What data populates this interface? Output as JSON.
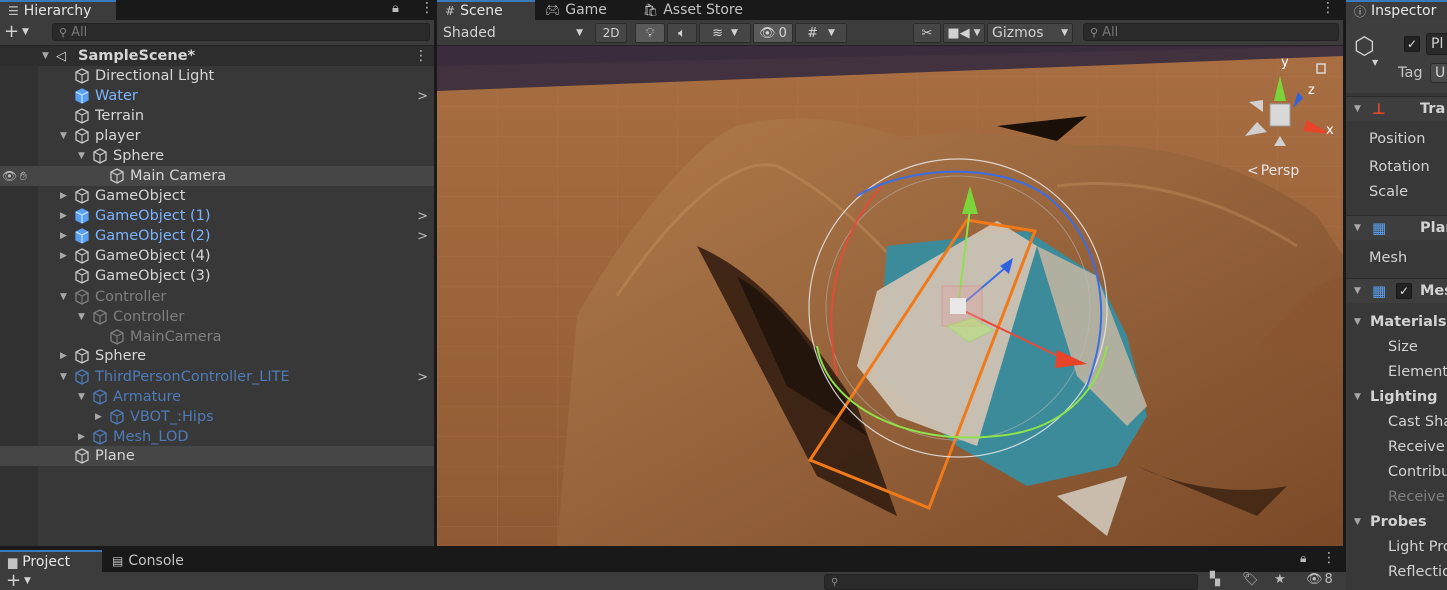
{
  "hierarchy": {
    "tab_label": "Hierarchy",
    "search_placeholder": "All",
    "scene_name": "SampleScene*",
    "items": [
      {
        "label": "Directional Light"
      },
      {
        "label": "Water"
      },
      {
        "label": "Terrain"
      },
      {
        "label": "player"
      },
      {
        "label": "Sphere"
      },
      {
        "label": "Main Camera"
      },
      {
        "label": "GameObject"
      },
      {
        "label": "GameObject (1)"
      },
      {
        "label": "GameObject (2)"
      },
      {
        "label": "GameObject (4)"
      },
      {
        "label": "GameObject (3)"
      },
      {
        "label": "Controller"
      },
      {
        "label": "Controller"
      },
      {
        "label": "MainCamera"
      },
      {
        "label": "Sphere"
      },
      {
        "label": "ThirdPersonController_LITE"
      },
      {
        "label": "Armature"
      },
      {
        "label": "VBOT_:Hips"
      },
      {
        "label": "Mesh_LOD"
      },
      {
        "label": "Plane"
      }
    ]
  },
  "scene": {
    "tabs": [
      {
        "label": "Scene",
        "icon": "grid-icon"
      },
      {
        "label": "Game",
        "icon": "gamepad-icon"
      },
      {
        "label": "Asset Store",
        "icon": "bag-icon"
      }
    ],
    "shading_mode": "Shaded",
    "two_d_label": "2D",
    "hidden_count": "0",
    "gizmos_label": "Gizmos",
    "search_placeholder": "All",
    "persp_label": "Persp",
    "axis_x": "x",
    "axis_y": "y",
    "axis_z": "z"
  },
  "inspector": {
    "tab_label": "Inspector",
    "object_name_partial": "Pl",
    "tag_label": "Tag",
    "tag_value_partial": "U",
    "rows": [
      {
        "label": "Tra"
      },
      {
        "label": "Position"
      },
      {
        "label": "Rotation"
      },
      {
        "label": "Scale"
      },
      {
        "label": "Plan"
      },
      {
        "label": "Mesh"
      },
      {
        "label": "Mes"
      },
      {
        "label": "Materials"
      },
      {
        "label": "Size"
      },
      {
        "label": "Element"
      },
      {
        "label": "Lighting"
      },
      {
        "label": "Cast Sha"
      },
      {
        "label": "Receive"
      },
      {
        "label": "Contribu"
      },
      {
        "label": "Receive"
      },
      {
        "label": "Probes"
      },
      {
        "label": "Light Pro"
      },
      {
        "label": "Reflectio"
      }
    ]
  },
  "bottom": {
    "tabs": [
      {
        "label": "Project",
        "icon": "folder-icon"
      },
      {
        "label": "Console",
        "icon": "console-icon"
      }
    ],
    "hidden_count": "8"
  },
  "colors": {
    "accent": "#3a79bb",
    "prefab_text": "#7cb3ff",
    "selection_orange": "#f07a1a",
    "water": "#3b8b9a",
    "terrain": "#a0663a"
  }
}
